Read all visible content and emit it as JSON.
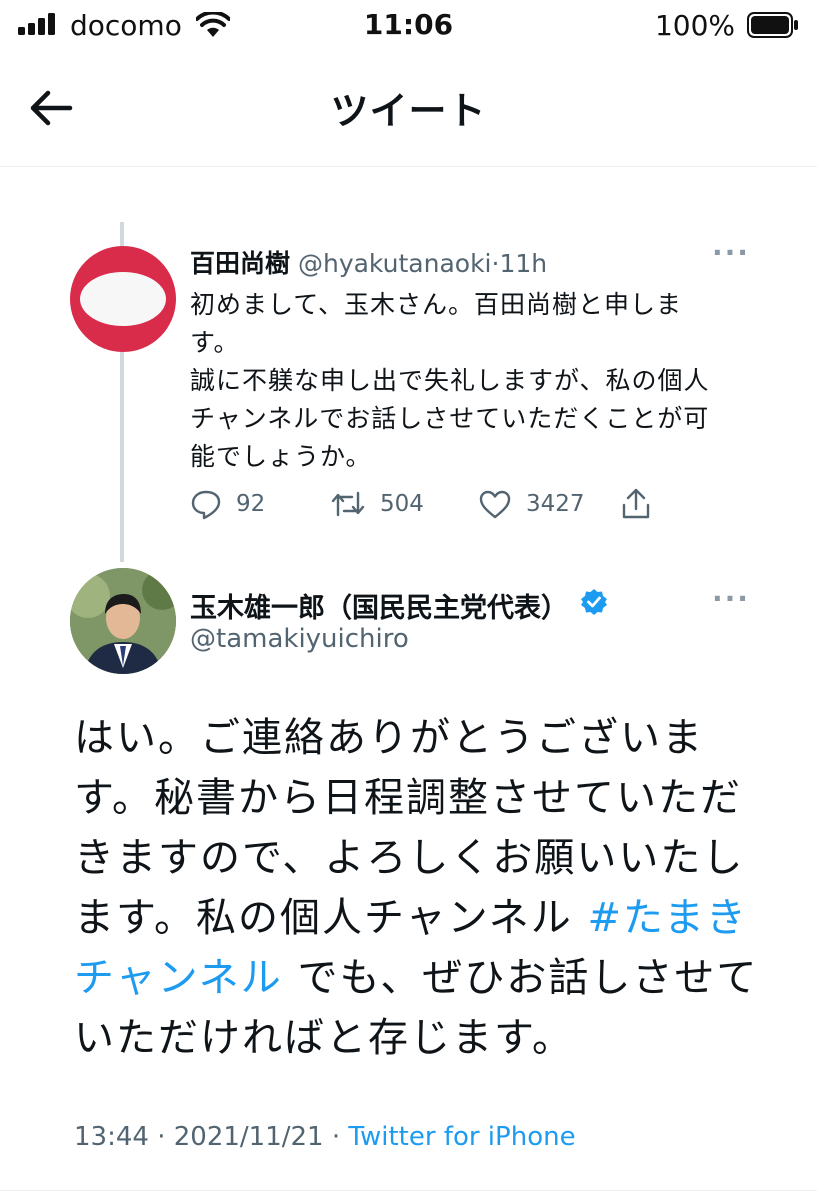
{
  "status_bar": {
    "carrier": "docomo",
    "time": "11:06",
    "battery": "100%"
  },
  "header": {
    "title": "ツイート"
  },
  "quoted_tweet": {
    "name": "百田尚樹",
    "handle": "@hyakutanaoki",
    "separator": "·",
    "time": "11h",
    "text_lines": [
      "初めまして、玉木さん。百田尚樹と申しま",
      "す。",
      "誠に不躾な申し出で失礼しますが、私の個人",
      "チャンネルでお話しさせていただくことが可",
      "能でしょうか。"
    ],
    "replies": "92",
    "retweets": "504",
    "likes": "3427"
  },
  "main_tweet": {
    "name": "玉木雄一郎（国民民主党代表）",
    "handle": "@tamakiyuichiro",
    "line1": "はい。ご連絡ありがとうございま",
    "line2": "す。秘書から日程調整させていただ",
    "line3": "きますので、よろしくお願いいたし",
    "line4_text": "ます。私の個人チャンネル ",
    "hashtag_part1": "#たまき",
    "hashtag_part2": "チャンネル",
    "line5_text": " でも、ぜひお話しさせて",
    "line6": "いただければと存じます。",
    "time": "13:44",
    "date": "2021/11/21",
    "source": "Twitter for iPhone"
  },
  "colors": {
    "link": "#1d9bf0",
    "secondary_text": "#536471",
    "quoted_avatar": "#d92b4a"
  },
  "icons": [
    "back-arrow-icon",
    "more-icon",
    "reply-icon",
    "retweet-icon",
    "like-icon",
    "share-icon",
    "verified-badge-icon",
    "wifi-icon",
    "battery-icon",
    "signal-icon"
  ]
}
